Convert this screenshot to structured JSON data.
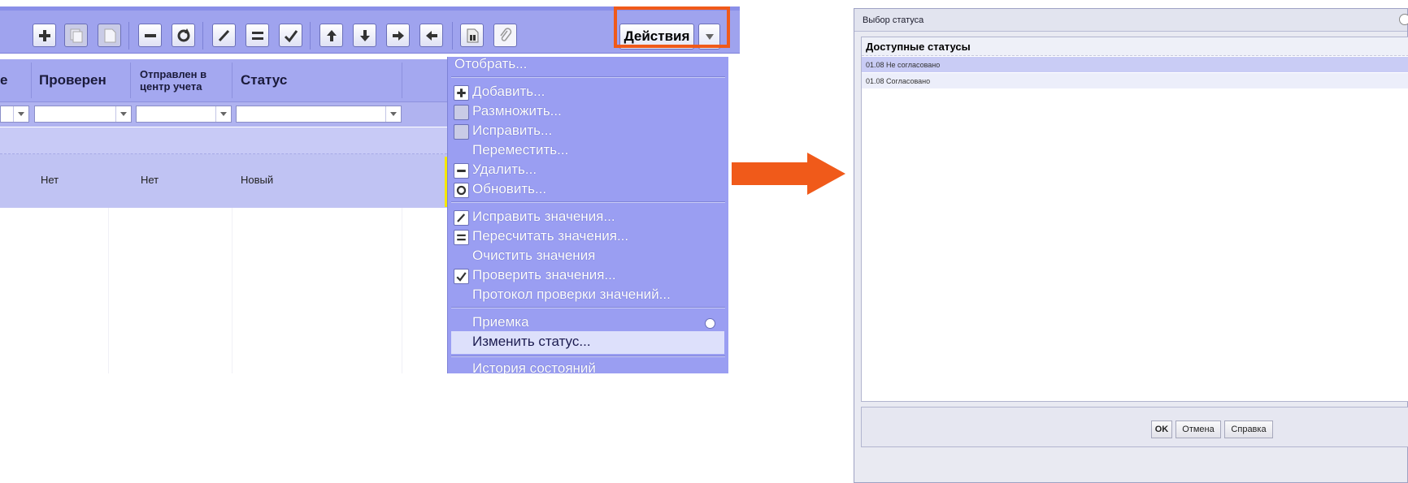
{
  "toolbar": {
    "actions_label": "Действия",
    "buttons": [
      "plus-icon",
      "copy-icon",
      "page-icon",
      "minus-icon",
      "refresh-icon",
      "pencil-icon",
      "equals-icon",
      "check-icon",
      "arrow-up-icon",
      "arrow-down-icon",
      "arrow-right-icon",
      "arrow-left-icon",
      "xls-icon",
      "paperclip-icon"
    ]
  },
  "grid": {
    "columns": [
      "е",
      "Проверен",
      "Отправлен в центр учета",
      "Статус"
    ],
    "row": [
      "Нет",
      "Нет",
      "Новый"
    ]
  },
  "menu": {
    "items": [
      {
        "label": "Отобрать...",
        "icon": ""
      },
      {
        "label": "Добавить...",
        "icon": "plus-icon"
      },
      {
        "label": "Размножить...",
        "icon": "copy-icon"
      },
      {
        "label": "Исправить...",
        "icon": "page-icon"
      },
      {
        "label": "Переместить...",
        "icon": ""
      },
      {
        "label": "Удалить...",
        "icon": "minus-icon"
      },
      {
        "label": "Обновить...",
        "icon": "refresh-icon"
      },
      {
        "label": "Исправить значения...",
        "icon": "pencil-icon"
      },
      {
        "label": "Пересчитать значения...",
        "icon": "equals-icon"
      },
      {
        "label": "Очистить значения",
        "icon": ""
      },
      {
        "label": "Проверить значения...",
        "icon": "check-icon"
      },
      {
        "label": "Протокол проверки значений...",
        "icon": ""
      },
      {
        "label": "Приемка",
        "icon": "submenu-arrow-icon"
      },
      {
        "label": "Изменить статус...",
        "icon": "",
        "selected": true
      },
      {
        "label": "История состояний",
        "icon": ""
      }
    ]
  },
  "dialog": {
    "title": "Выбор статуса",
    "list_header": "Доступные статусы",
    "statuses": [
      "01.08 Не согласовано",
      "01.08 Согласовано"
    ],
    "ok_label": "OK",
    "cancel_label": "Отмена",
    "help_label": "Справка"
  },
  "colors": {
    "toolbar": "#9fa3ee",
    "menu": "#9a9ef2",
    "highlight": "#f05a1a",
    "arrow": "#f05a1a"
  }
}
